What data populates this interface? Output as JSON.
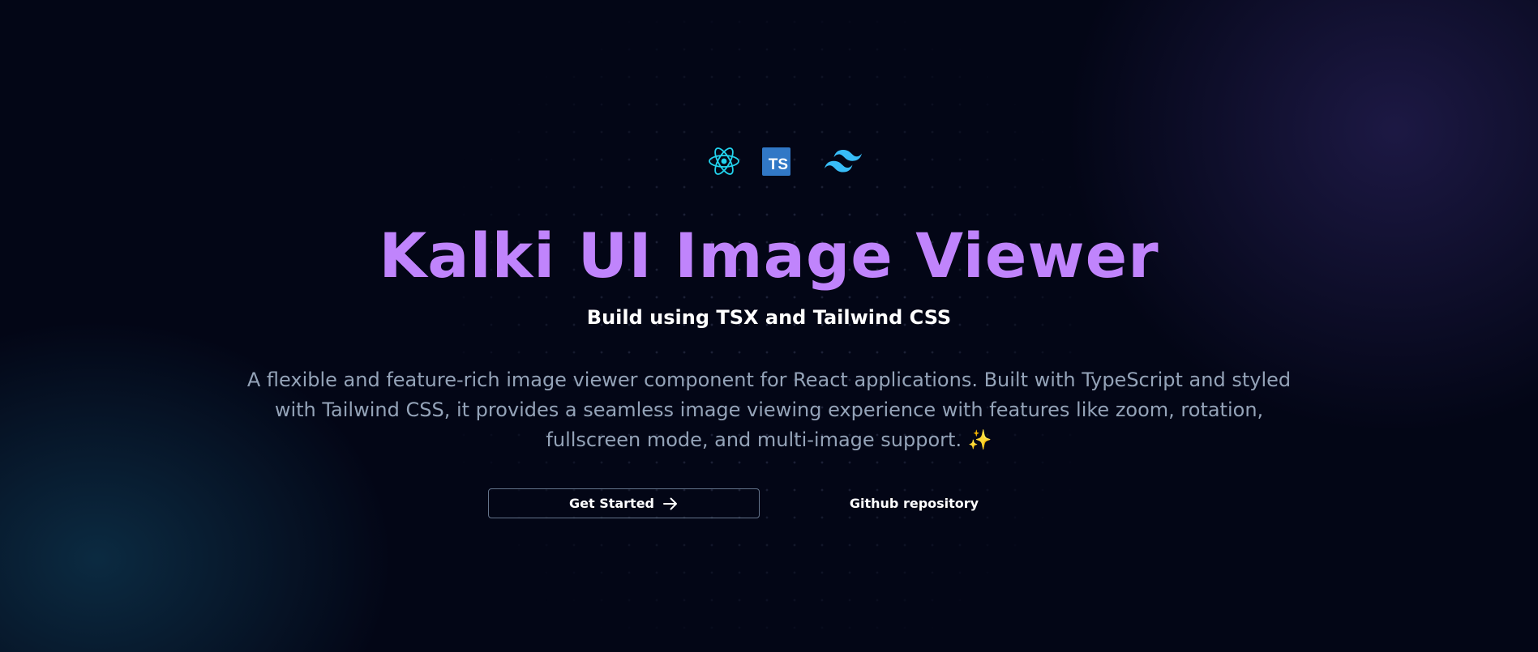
{
  "hero": {
    "icons": [
      "react-icon",
      "typescript-icon",
      "tailwind-icon"
    ],
    "ts_badge_text": "TS",
    "title": "Kalki UI Image Viewer",
    "subtitle": "Build using TSX and Tailwind CSS",
    "description": "A flexible and feature-rich image viewer component for React applications. Built with TypeScript and styled with Tailwind CSS, it provides a seamless image viewing experience with features like zoom, rotation, fullscreen mode, and multi-image support. ✨"
  },
  "actions": {
    "get_started_label": "Get Started",
    "get_started_icon": "arrow-right-icon",
    "github_label": "Github repository"
  },
  "colors": {
    "background": "#030616",
    "title": "#c084fc",
    "description": "#94a3b8",
    "react": "#22d3ee",
    "typescript": "#3178c6",
    "tailwind": "#38bdf8"
  }
}
